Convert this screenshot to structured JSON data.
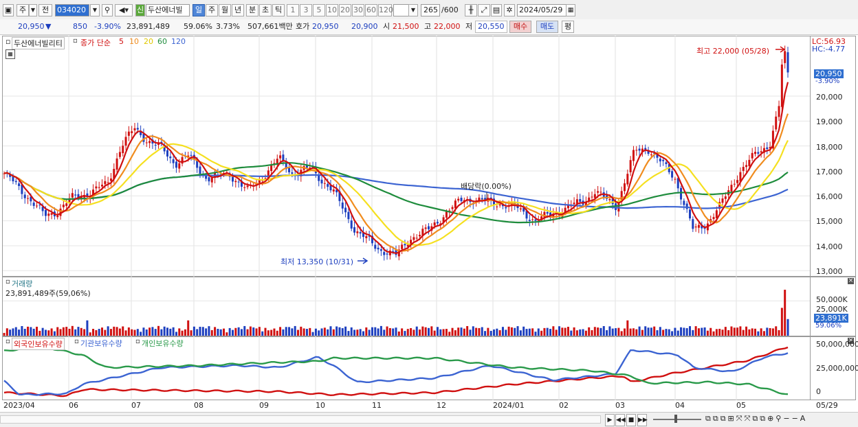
{
  "toolbar": {
    "market_label": "주",
    "prev_label": "전",
    "code_value": "034020",
    "stock_name": "두산에너빌",
    "new_badge": "신",
    "periods": [
      "일",
      "주",
      "월",
      "년",
      "분",
      "초",
      "틱"
    ],
    "intervals": [
      "1",
      "3",
      "5",
      "10",
      "20",
      "30",
      "60",
      "120"
    ],
    "count_value": "265",
    "count_max": "/600",
    "date_value": "2024/05/29"
  },
  "quote": {
    "price": "20,950",
    "change_arrow": "▼",
    "change": "850",
    "change_pct": "-3.90%",
    "volume": "23,891,489",
    "volume_ratio": "59.06%",
    "turnover": "3.73%",
    "amount": "507,661백만",
    "ask_label": "호가",
    "ask": "20,950",
    "bid": "20,900",
    "open_label": "시",
    "open": "21,500",
    "high_label": "고",
    "high": "22,000",
    "low_label": "저",
    "low": "20,550",
    "buy_label": "매수",
    "sell_label": "매도",
    "avg_label": "평"
  },
  "price_panel": {
    "title": "두산에너빌리티",
    "ma_label": "종가 단순",
    "ma_periods": [
      "5",
      "10",
      "20",
      "60",
      "120"
    ],
    "annotation_high": "최고 22,000 (05/28)",
    "annotation_low": "최저 13,350 (10/31)",
    "annotation_div": "배당락(0.00%)",
    "lc": "LC:56.93",
    "hc": "HC:-4.77",
    "current_tag": "20,950",
    "current_pct": "-3.90%",
    "y_ticks": [
      "20,000",
      "19,000",
      "18,000",
      "17,000",
      "16,000",
      "15,000",
      "14,000",
      "13,000"
    ]
  },
  "volume_panel": {
    "title": "거래량",
    "info": "23,891,489주(59,06%)",
    "y_ticks": [
      "50,000K",
      "25,000K"
    ],
    "current_tag": "23,891K",
    "current_pct": "59.06%"
  },
  "holding_panel": {
    "legends": [
      "외국인보유수량",
      "기관보유수량",
      "개인보유수량"
    ],
    "y_ticks": [
      "50,000,000",
      "25,000,000",
      "0"
    ]
  },
  "x_axis": {
    "labels": [
      "2023/04",
      "06",
      "07",
      "08",
      "09",
      "10",
      "11",
      "12",
      "2024/01",
      "02",
      "03",
      "04",
      "05"
    ],
    "right_label": "05/29"
  },
  "colors": {
    "up": "#d01010",
    "down": "#1d3fbf",
    "ma5": "#d01010",
    "ma10": "#f08c1e",
    "ma20": "#f5e020",
    "ma60": "#1e8c3c",
    "ma120": "#3c64d2",
    "foreign": "#d01010",
    "institution": "#3c64d2",
    "individual": "#2a9a4a",
    "accent": "#2f6fd0"
  },
  "chart_data": [
    {
      "type": "line",
      "title": "두산에너빌리티",
      "ylim": [
        13000,
        22500
      ],
      "ma_periods": [
        5,
        10,
        20,
        60,
        120
      ],
      "ohlc_summary": {
        "high": 22000,
        "high_date": "05/28",
        "low": 13350,
        "low_date": "10/31",
        "last": 20950
      },
      "series": [
        {
          "name": "종가",
          "x": [
            "2023/04",
            "2023/05",
            "2023/06",
            "2023/07",
            "2023/08",
            "2023/09",
            "2023/10",
            "2023/11",
            "2023/12",
            "2024/01",
            "2024/02",
            "2024/03",
            "2024/04",
            "2024/05",
            "2024/05/28"
          ],
          "values": [
            16900,
            15300,
            18800,
            18200,
            16600,
            17400,
            14700,
            13800,
            15900,
            15200,
            15700,
            17800,
            14600,
            18100,
            22000
          ]
        }
      ]
    },
    {
      "type": "bar",
      "title": "거래량",
      "ylim": [
        0,
        70000
      ],
      "last_value_k": 23891
    },
    {
      "type": "line",
      "legends": [
        "외국인보유수량",
        "기관보유수량",
        "개인보유수량"
      ],
      "ylim": [
        0,
        55000000
      ],
      "series": [
        {
          "name": "외국인보유수량",
          "x": [
            "2023/04",
            "2023/06",
            "2023/09",
            "2023/10",
            "2024/01",
            "2024/03",
            "2024/05"
          ],
          "values": [
            3000000,
            7000000,
            5000000,
            2000000,
            12000000,
            20000000,
            48000000
          ]
        },
        {
          "name": "기관보유수량",
          "x": [
            "2023/04",
            "2023/06",
            "2023/09",
            "2023/10",
            "2024/01",
            "2024/03",
            "2024/05"
          ],
          "values": [
            15000000,
            22000000,
            30000000,
            15000000,
            20000000,
            48000000,
            42000000
          ]
        },
        {
          "name": "개인보유수량",
          "x": [
            "2023/04",
            "2023/06",
            "2023/09",
            "2023/10",
            "2024/01",
            "2024/03",
            "2024/05"
          ],
          "values": [
            44000000,
            28000000,
            32000000,
            38000000,
            28000000,
            10000000,
            2000000
          ]
        }
      ]
    }
  ]
}
